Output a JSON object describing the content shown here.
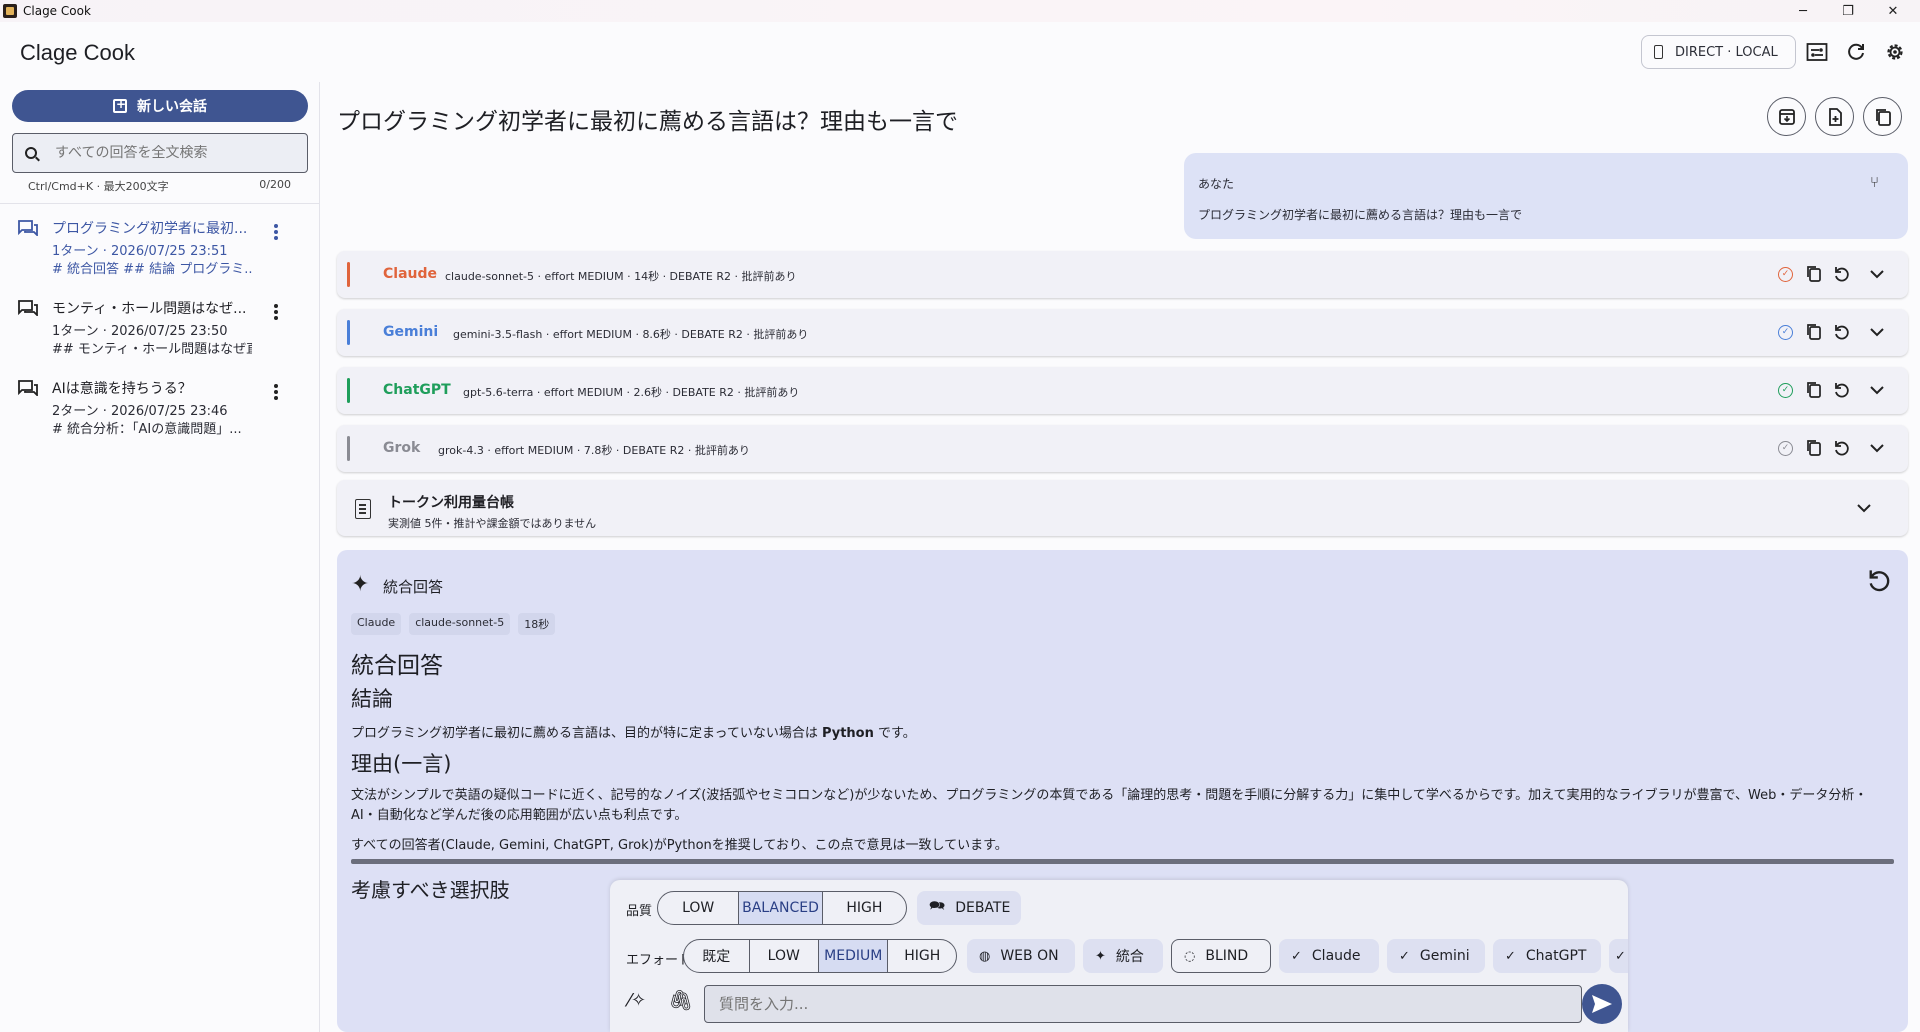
{
  "window": {
    "title": "Clage Cook",
    "minimize": "─",
    "restore": "❐",
    "close": "✕"
  },
  "header": {
    "app_name": "Clage Cook",
    "mode_chip": "DIRECT · LOCAL",
    "icons": [
      "compare-icon",
      "refresh-icon",
      "gear-icon"
    ]
  },
  "sidebar": {
    "new_chat": "新しい会話",
    "search_placeholder": "すべての回答を全文検索",
    "search_hint": "Ctrl/Cmd+K · 最大200文字",
    "search_count": "0/200",
    "conversations": [
      {
        "title": "プログラミング初学者に最初...",
        "meta": "1ターン · 2026/07/25 23:51",
        "preview": "# 統合回答 ## 結論 プログラミ..."
      },
      {
        "title": "モンティ・ホール問題はなぜ...",
        "meta": "1ターン · 2026/07/25 23:50",
        "preview": "## モンティ・ホール問題はなぜ直..."
      },
      {
        "title": "AIは意識を持ちうる？",
        "meta": "2ターン · 2026/07/25 23:46",
        "preview": "# 統合分析：「AIの意識問題」..."
      }
    ]
  },
  "main": {
    "title": "プログラミング初学者に最初に薦める言語は？理由も一言で",
    "user": {
      "label": "あなた",
      "message": "プログラミング初学者に最初に薦める言語は？理由も一言で"
    },
    "models": [
      {
        "name": "Claude",
        "meta": "claude-sonnet-5 · effort MEDIUM · 14秒 · DEBATE R2 · 批評前あり",
        "color": "#e0643c",
        "status_color": "#e0643c"
      },
      {
        "name": "Gemini",
        "meta": "gemini-3.5-flash · effort MEDIUM · 8.6秒 · DEBATE R2 · 批評前あり",
        "color": "#4a7fd8",
        "status_color": "#4a7fd8"
      },
      {
        "name": "ChatGPT",
        "meta": "gpt-5.6-terra · effort MEDIUM · 2.6秒 · DEBATE R2 · 批評前あり",
        "color": "#1f9e5b",
        "status_color": "#1f9e5b"
      },
      {
        "name": "Grok",
        "meta": "grok-4.3 · effort MEDIUM · 7.8秒 · DEBATE R2 · 批評前あり",
        "color": "#8a8b93",
        "status_color": "#8a8b93"
      }
    ],
    "token": {
      "title": "トークン利用量台帳",
      "subtitle": "実測値 5件・推計や課金額ではありません"
    },
    "synthesis": {
      "header": "統合回答",
      "tags": [
        "Claude",
        "claude-sonnet-5",
        "18秒"
      ],
      "h1": "統合回答",
      "h2_conclusion": "結論",
      "conclusion_pre": "プログラミング初学者に最初に薦める言語は、目的が特に定まっていない場合は ",
      "conclusion_bold": "Python",
      "conclusion_post": " です。",
      "h2_reason": "理由(一言)",
      "reason": "文法がシンプルで英語の疑似コードに近く、記号的なノイズ(波括弧やセミコロンなど)が少ないため、プログラミングの本質である「論理的思考・問題を手順に分解する力」に集中して学べるからです。加えて実用的なライブラリが豊富で、Web・データ分析・AI・自動化など学んだ後の応用範囲が広い点も利点です。",
      "consensus": "すべての回答者(Claude, Gemini, ChatGPT, Grok)がPythonを推奨しており、この点で意見は一致しています。",
      "next_heading": "考慮すべき選択肢"
    }
  },
  "composer": {
    "quality_label": "品質",
    "quality_options": [
      "LOW",
      "BALANCED",
      "HIGH"
    ],
    "quality_selected": "BALANCED",
    "debate": "DEBATE",
    "effort_label": "エフォート",
    "effort_options": [
      "既定",
      "LOW",
      "MEDIUM",
      "HIGH"
    ],
    "effort_selected": "MEDIUM",
    "web": "WEB ON",
    "synth": "統合",
    "blind": "BLIND",
    "model_toggles": [
      "Claude",
      "Gemini",
      "ChatGPT"
    ],
    "placeholder": "質問を入力..."
  },
  "colors": {
    "accent": "#3f5591",
    "user_bubble": "#dde2f6",
    "synth_bg": "#dde0f5"
  }
}
